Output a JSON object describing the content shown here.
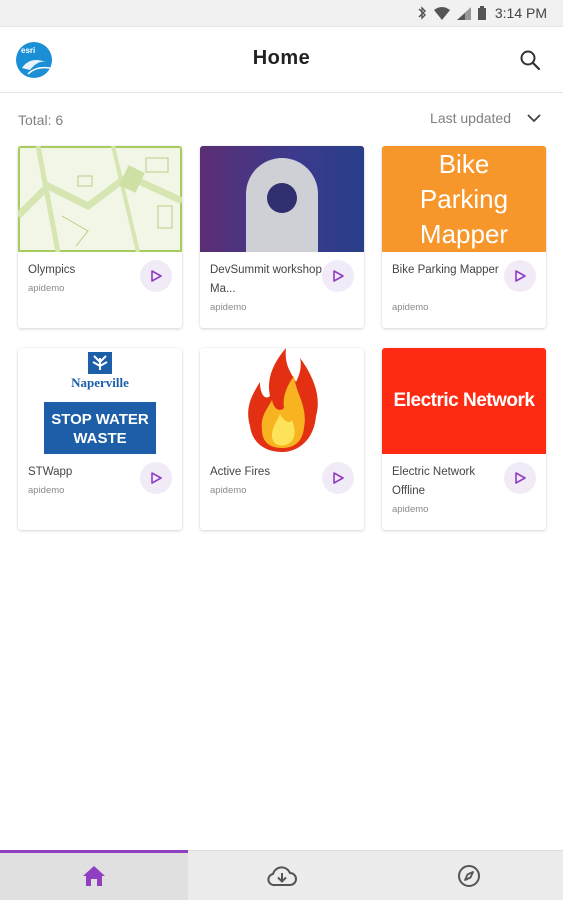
{
  "status": {
    "time": "3:14 PM"
  },
  "header": {
    "title": "Home",
    "logo_text": "esri"
  },
  "toolbar": {
    "total": "Total: 6",
    "sort": "Last updated"
  },
  "apps": [
    {
      "title": "Olympics",
      "owner": "apidemo"
    },
    {
      "title": "DevSummit workshop Ma...",
      "owner": "apidemo"
    },
    {
      "title": "Bike Parking Mapper",
      "owner": "apidemo",
      "thumb_text": [
        "Bike",
        "Parking",
        "Mapper"
      ]
    },
    {
      "title": "STWapp",
      "owner": "apidemo",
      "thumb_text": [
        "Naperville",
        "STOP WATER",
        "WASTE"
      ]
    },
    {
      "title": "Active Fires",
      "owner": "apidemo"
    },
    {
      "title": "Electric Network Offline",
      "owner": "apidemo",
      "thumb_text": [
        "Electric Network"
      ]
    }
  ],
  "nav": {
    "items": [
      "home-icon",
      "cloud-download-icon",
      "compass-icon"
    ]
  },
  "colors": {
    "accent": "#8f3fbf",
    "bike": "#f6962b",
    "electric": "#ff2a12",
    "devsummit": "#4b3a8a"
  }
}
